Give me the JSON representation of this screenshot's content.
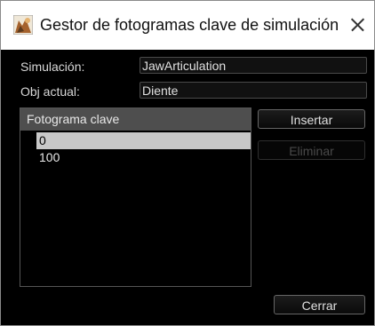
{
  "window": {
    "title": "Gestor de fotogramas clave de simulación"
  },
  "form": {
    "simulation_label": "Simulación:",
    "simulation_value": "JawArticulation",
    "current_object_label": "Obj actual:",
    "current_object_value": "Diente"
  },
  "keyframes": {
    "header": "Fotograma clave",
    "items": [
      "0",
      "100"
    ],
    "selected_index": 0
  },
  "buttons": {
    "insert": "Insertar",
    "delete": "Eliminar",
    "close": "Cerrar"
  },
  "icons": {
    "app": "simulation-app-icon",
    "close": "close-x-icon"
  }
}
